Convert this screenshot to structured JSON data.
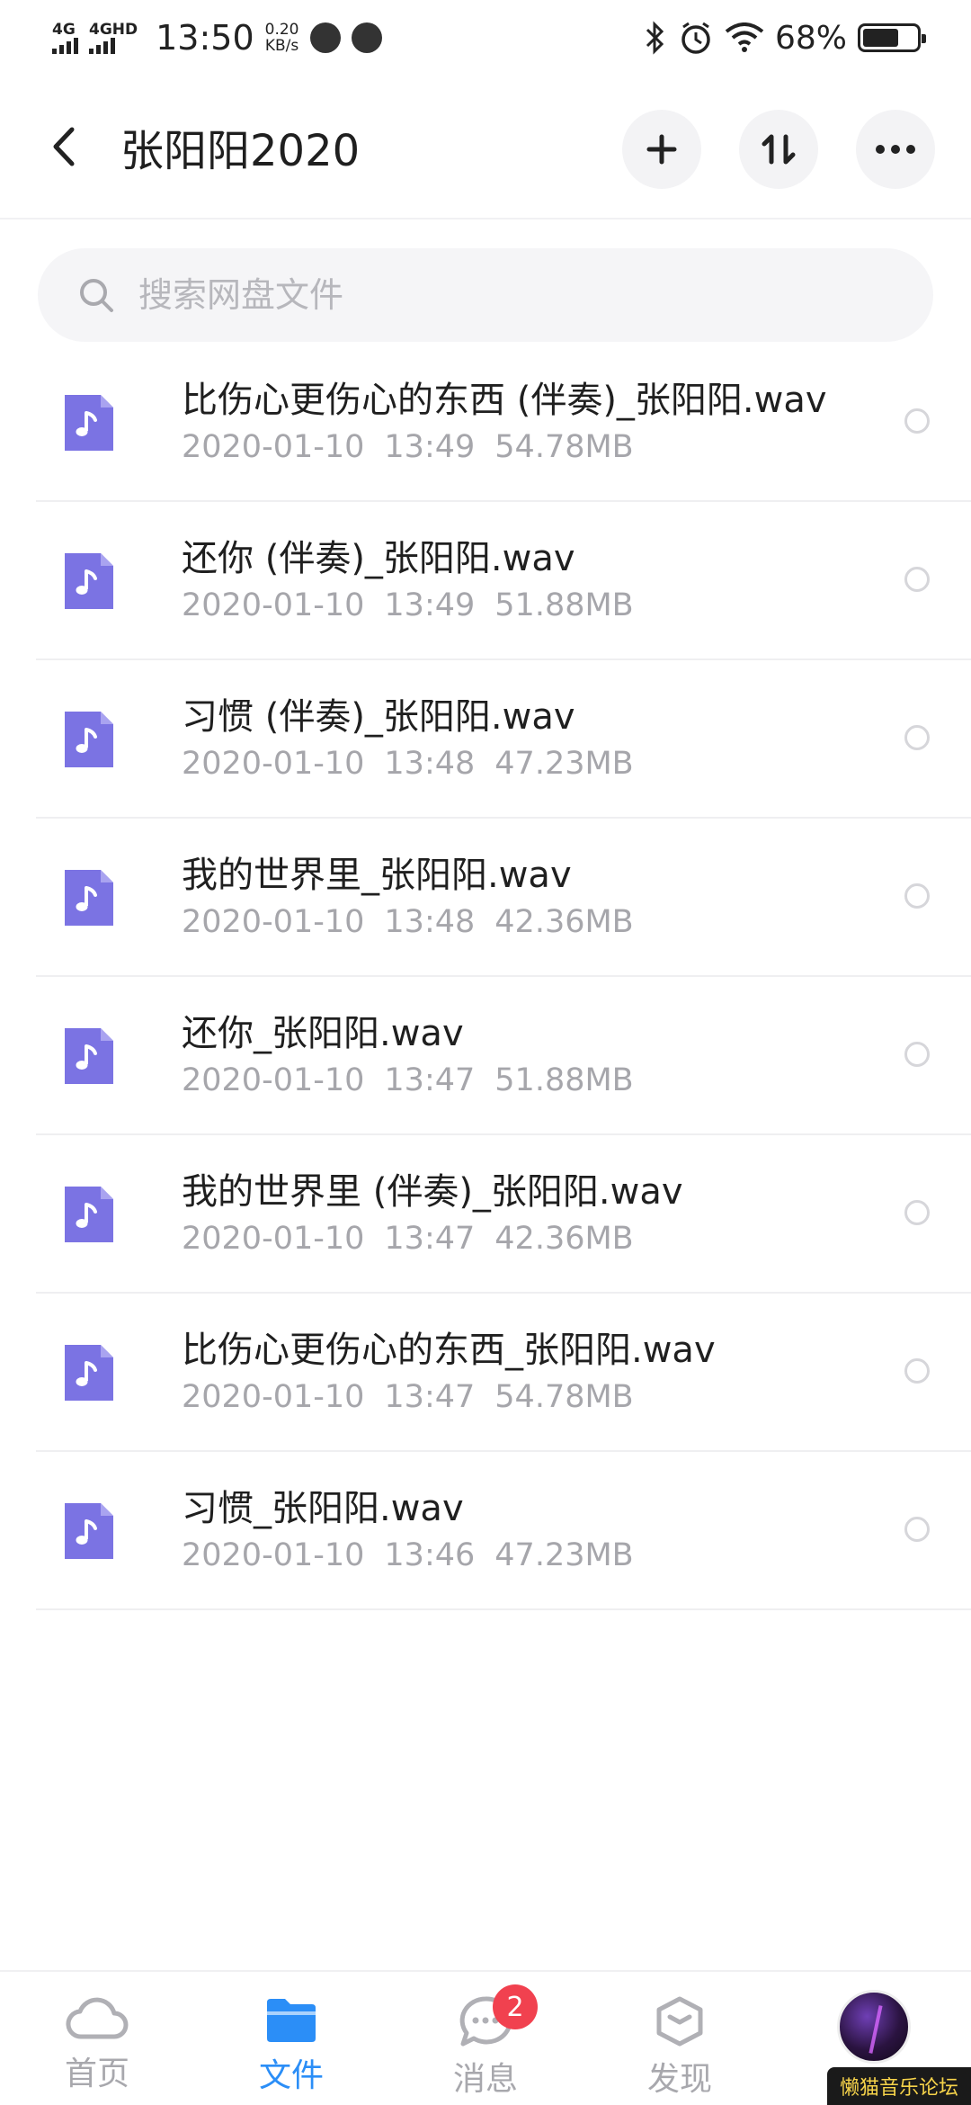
{
  "status_bar": {
    "network1": "4G",
    "network2": "4GHD",
    "time": "13:50",
    "speed_value": "0.20",
    "speed_unit": "KB/s",
    "battery_percent": "68%",
    "battery_level": 0.68,
    "icons": [
      "weibo-icon",
      "browser-icon",
      "bluetooth-icon",
      "alarm-icon",
      "wifi-icon",
      "battery-icon"
    ]
  },
  "header": {
    "title": "张阳阳2020",
    "actions": [
      "add-icon",
      "sort-icon",
      "more-icon"
    ]
  },
  "search": {
    "placeholder": "搜索网盘文件"
  },
  "files": [
    {
      "name": "比伤心更伤心的东西 (伴奏)_张阳阳.wav",
      "date": "2020-01-10",
      "time": "13:49",
      "size": "54.78MB"
    },
    {
      "name": "还你 (伴奏)_张阳阳.wav",
      "date": "2020-01-10",
      "time": "13:49",
      "size": "51.88MB"
    },
    {
      "name": "习惯 (伴奏)_张阳阳.wav",
      "date": "2020-01-10",
      "time": "13:48",
      "size": "47.23MB"
    },
    {
      "name": "我的世界里_张阳阳.wav",
      "date": "2020-01-10",
      "time": "13:48",
      "size": "42.36MB"
    },
    {
      "name": "还你_张阳阳.wav",
      "date": "2020-01-10",
      "time": "13:47",
      "size": "51.88MB"
    },
    {
      "name": "我的世界里 (伴奏)_张阳阳.wav",
      "date": "2020-01-10",
      "time": "13:47",
      "size": "42.36MB"
    },
    {
      "name": "比伤心更伤心的东西_张阳阳.wav",
      "date": "2020-01-10",
      "time": "13:47",
      "size": "54.78MB"
    },
    {
      "name": "习惯_张阳阳.wav",
      "date": "2020-01-10",
      "time": "13:46",
      "size": "47.23MB"
    }
  ],
  "bottom_nav": {
    "home": "首页",
    "files": "文件",
    "messages": "消息",
    "messages_badge": "2",
    "discover": "发现",
    "active": "files"
  },
  "watermark": "懒猫音乐论坛",
  "colors": {
    "accent": "#2b8ef7",
    "file_icon": "#7b73e3",
    "badge": "#f1414f"
  }
}
